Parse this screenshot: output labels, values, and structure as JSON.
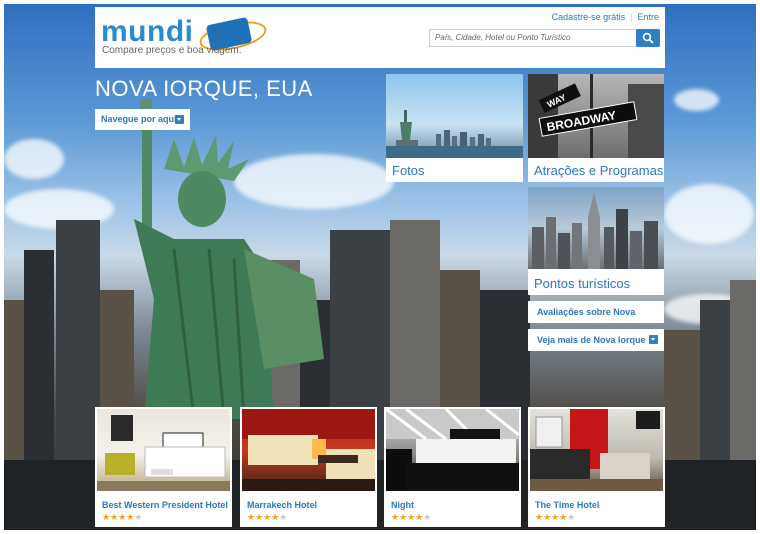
{
  "header": {
    "logo_text": "mundi",
    "tagline": "Compare preços e boa viagem.",
    "signup_link": "Cadastre-se grátis",
    "login_link": "Entre",
    "search_placeholder": "País, Cidade, Hotel ou Ponto Turístico"
  },
  "city": {
    "title": "NOVA IORQUE, EUA",
    "nav_button": "Navegue por aqui"
  },
  "tiles": {
    "fotos": "Fotos",
    "atracoes": "Atrações e Programas",
    "pontos": "Pontos turísticos",
    "broadway_sign": "BROADWAY",
    "way_sign": "WAY"
  },
  "links": {
    "avaliacoes": "Avaliações sobre Nova Iorque",
    "veja_mais": "Veja mais de Nova Iorque"
  },
  "hotels": [
    {
      "name": "Best Western President Hotel",
      "rating": 4,
      "max": 5
    },
    {
      "name": "Marrakech Hotel",
      "rating": 4,
      "max": 5
    },
    {
      "name": "Night",
      "rating": 4,
      "max": 5
    },
    {
      "name": "The Time Hotel",
      "rating": 4,
      "max": 5
    }
  ],
  "colors": {
    "accent": "#2a78c0",
    "button": "#2f7ec6",
    "star": "#f0a020"
  }
}
